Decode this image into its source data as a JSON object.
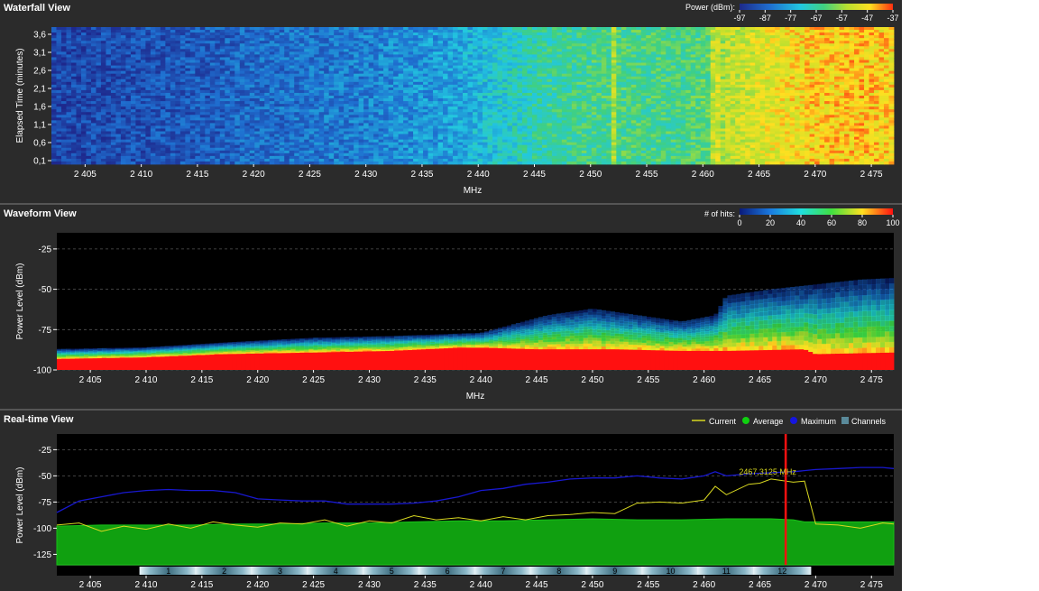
{
  "colors": {
    "background": "#2b2b2b",
    "plot_background": "#000000",
    "current": "#d8d820",
    "average": "#10b010",
    "maximum": "#1515c8",
    "channels": "#5a8a9a",
    "marker": "#ff0000"
  },
  "chart_data": [
    {
      "type": "heatmap",
      "title": "Waterfall View",
      "xlabel": "MHz",
      "ylabel": "Elapsed Time (minutes)",
      "xlim": [
        2402,
        2477
      ],
      "ylim": [
        0,
        3.8
      ],
      "x_ticks": [
        2405,
        2410,
        2415,
        2420,
        2425,
        2430,
        2435,
        2440,
        2445,
        2450,
        2455,
        2460,
        2465,
        2470,
        2475
      ],
      "x_tick_labels": [
        "2 405",
        "2 410",
        "2 415",
        "2 420",
        "2 425",
        "2 430",
        "2 435",
        "2 440",
        "2 445",
        "2 450",
        "2 455",
        "2 460",
        "2 465",
        "2 470",
        "2 475"
      ],
      "y_ticks": [
        0.1,
        0.6,
        1.1,
        1.6,
        2.1,
        2.6,
        3.1,
        3.6
      ],
      "y_tick_labels": [
        "0,1",
        "0,6",
        "1,1",
        "1,6",
        "2,1",
        "2,6",
        "3,1",
        "3,6"
      ],
      "colorbar": {
        "label": "Power (dBm):",
        "ticks": [
          -97,
          -87,
          -77,
          -67,
          -57,
          -47,
          -37
        ],
        "tick_labels": [
          "-97",
          "-87",
          "-77",
          "-67",
          "-57",
          "-47",
          "-37"
        ]
      },
      "power_profile": {
        "x": [
          2402,
          2410,
          2417,
          2420,
          2430,
          2438,
          2442,
          2446,
          2452,
          2458,
          2461,
          2462,
          2466,
          2470,
          2474,
          2477
        ],
        "y": [
          -92,
          -90,
          -88,
          -86,
          -83,
          -78,
          -72,
          -67,
          -64,
          -65,
          -62,
          -54,
          -50,
          -46,
          -45,
          -47
        ]
      }
    },
    {
      "type": "heatmap",
      "title": "Waveform View",
      "xlabel": "MHz",
      "ylabel": "Power Level (dBm)",
      "xlim": [
        2402,
        2477
      ],
      "ylim": [
        -100,
        -15
      ],
      "x_ticks": [
        2405,
        2410,
        2415,
        2420,
        2425,
        2430,
        2435,
        2440,
        2445,
        2450,
        2455,
        2460,
        2465,
        2470,
        2475
      ],
      "x_tick_labels": [
        "2 405",
        "2 410",
        "2 415",
        "2 420",
        "2 425",
        "2 430",
        "2 435",
        "2 440",
        "2 445",
        "2 450",
        "2 455",
        "2 460",
        "2 465",
        "2 470",
        "2 475"
      ],
      "y_ticks": [
        -100,
        -75,
        -50,
        -25
      ],
      "y_tick_labels": [
        "-100",
        "-75",
        "-50",
        "-25"
      ],
      "colorbar": {
        "label": "# of hits:",
        "ticks": [
          0,
          20,
          40,
          60,
          80,
          100
        ],
        "tick_labels": [
          "0",
          "20",
          "40",
          "60",
          "80",
          "100"
        ]
      },
      "floor_profile": {
        "x": [
          2402,
          2410,
          2417,
          2425,
          2432,
          2438,
          2440,
          2445,
          2452,
          2458,
          2462,
          2469,
          2470,
          2477
        ],
        "y": [
          -93,
          -92,
          -90,
          -89,
          -88,
          -86,
          -86,
          -87,
          -87,
          -88,
          -88,
          -87,
          -90,
          -89
        ]
      },
      "upper_profile": {
        "x": [
          2402,
          2410,
          2417,
          2425,
          2432,
          2440,
          2446,
          2450,
          2453,
          2458,
          2461,
          2462,
          2466,
          2470,
          2474,
          2477
        ],
        "y": [
          -87,
          -86,
          -83,
          -80,
          -79,
          -77,
          -66,
          -62,
          -65,
          -70,
          -66,
          -54,
          -50,
          -47,
          -44,
          -43
        ]
      }
    },
    {
      "type": "line",
      "title": "Real-time View",
      "xlabel": "",
      "ylabel": "Power Level (dBm)",
      "xlim": [
        2402,
        2477
      ],
      "ylim": [
        -135,
        -10
      ],
      "x_ticks": [
        2405,
        2410,
        2415,
        2420,
        2425,
        2430,
        2435,
        2440,
        2445,
        2450,
        2455,
        2460,
        2465,
        2470,
        2475
      ],
      "x_tick_labels": [
        "2 405",
        "2 410",
        "2 415",
        "2 420",
        "2 425",
        "2 430",
        "2 435",
        "2 440",
        "2 445",
        "2 450",
        "2 455",
        "2 460",
        "2 465",
        "2 470",
        "2 475"
      ],
      "y_ticks": [
        -125,
        -100,
        -75,
        -50,
        -25
      ],
      "y_tick_labels": [
        "-125",
        "-100",
        "-75",
        "-50",
        "-25"
      ],
      "legend": [
        "Current",
        "Average",
        "Maximum",
        "Channels"
      ],
      "legend_position": "top-right",
      "marker": {
        "x": 2467.3125,
        "label": "2467,3125 MHz"
      },
      "channels": {
        "labels": [
          "1",
          "2",
          "3",
          "4",
          "5",
          "6",
          "7",
          "8",
          "9",
          "10",
          "11",
          "12"
        ],
        "centers": [
          2412,
          2417,
          2422,
          2427,
          2432,
          2437,
          2442,
          2447,
          2452,
          2457,
          2462,
          2467
        ]
      },
      "series": [
        {
          "name": "Maximum",
          "x": [
            2402,
            2404,
            2406,
            2408,
            2410,
            2412,
            2414,
            2416,
            2418,
            2420,
            2422,
            2424,
            2426,
            2428,
            2430,
            2432,
            2434,
            2436,
            2438,
            2440,
            2442,
            2444,
            2446,
            2448,
            2450,
            2452,
            2454,
            2456,
            2458,
            2460,
            2461,
            2462,
            2464,
            2466,
            2468,
            2470,
            2472,
            2474,
            2476,
            2477
          ],
          "y": [
            -85,
            -74,
            -70,
            -66,
            -64,
            -63,
            -64,
            -64,
            -66,
            -72,
            -73,
            -74,
            -74,
            -77,
            -77,
            -77,
            -76,
            -74,
            -70,
            -64,
            -62,
            -58,
            -56,
            -53,
            -52,
            -52,
            -50,
            -52,
            -53,
            -50,
            -46,
            -50,
            -48,
            -47,
            -46,
            -44,
            -43,
            -42,
            -42,
            -43
          ]
        },
        {
          "name": "Average",
          "x": [
            2402,
            2406,
            2410,
            2414,
            2418,
            2422,
            2426,
            2430,
            2434,
            2438,
            2442,
            2446,
            2450,
            2454,
            2458,
            2462,
            2466,
            2468,
            2469,
            2472,
            2477
          ],
          "y": [
            -98,
            -97,
            -97,
            -97,
            -96,
            -96,
            -95,
            -95,
            -94,
            -93,
            -93,
            -92,
            -91,
            -92,
            -92,
            -91,
            -91,
            -92,
            -94,
            -94,
            -94
          ]
        },
        {
          "name": "Current",
          "x": [
            2402,
            2404,
            2406,
            2408,
            2410,
            2412,
            2414,
            2416,
            2418,
            2420,
            2422,
            2424,
            2426,
            2428,
            2430,
            2432,
            2434,
            2436,
            2438,
            2440,
            2442,
            2444,
            2446,
            2448,
            2450,
            2452,
            2454,
            2456,
            2458,
            2460,
            2461,
            2462,
            2464,
            2465,
            2466,
            2468,
            2469,
            2470,
            2472,
            2474,
            2476,
            2477
          ],
          "y": [
            -97,
            -95,
            -103,
            -98,
            -101,
            -96,
            -100,
            -94,
            -97,
            -99,
            -95,
            -96,
            -92,
            -98,
            -93,
            -95,
            -88,
            -92,
            -90,
            -93,
            -89,
            -92,
            -88,
            -87,
            -85,
            -86,
            -76,
            -75,
            -76,
            -73,
            -60,
            -68,
            -58,
            -57,
            -53,
            -56,
            -55,
            -96,
            -97,
            -100,
            -95,
            -96
          ]
        }
      ]
    }
  ]
}
